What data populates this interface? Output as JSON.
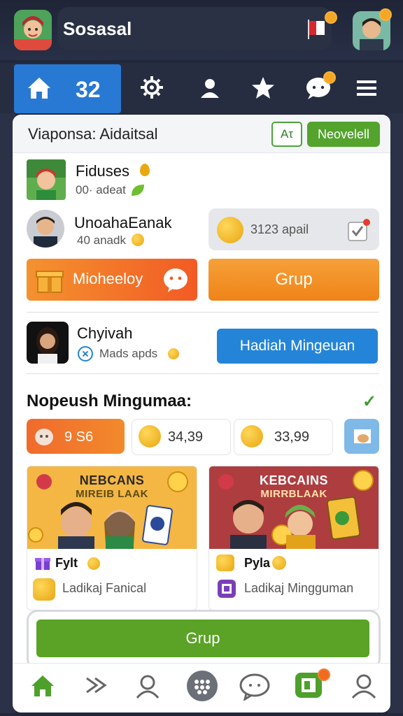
{
  "app": {
    "title": "Sosasal"
  },
  "nav": {
    "home_count": "32"
  },
  "header": {
    "title": "Viaponsa: Aidaitsal",
    "ai_button": "Aτ",
    "new_button": "Neovelell"
  },
  "users": [
    {
      "name": "Fiduses",
      "sub": "00· adeat"
    },
    {
      "name": "UnoahaEanak",
      "sub": "40 anadk"
    },
    {
      "name": "Chyivah",
      "sub": "Mads apds"
    }
  ],
  "stat": {
    "text": "3123 apail"
  },
  "buttons": {
    "promo_left": "Mioheeloy",
    "grup_top": "Grup",
    "hadiah": "Hadiah Mingeuan",
    "grup_bottom": "Grup"
  },
  "section": {
    "title": "Nopeush Mingumaa:"
  },
  "chips": [
    "9 S6",
    "34,39",
    "33,99"
  ],
  "promos": [
    {
      "banner_line1": "NEBCANS",
      "banner_line2": "MIREIB LAAK",
      "label1": "Fylt",
      "label2": "Ladikaj Fanical"
    },
    {
      "banner_line1": "KEBCAINS",
      "banner_line2": "MIRRBLAAK",
      "label1": "Pyla",
      "label2": "Ladikaj Mingguman"
    }
  ],
  "colors": {
    "accent_blue": "#2879d4",
    "green": "#53a32d",
    "orange": "#ef8417"
  }
}
